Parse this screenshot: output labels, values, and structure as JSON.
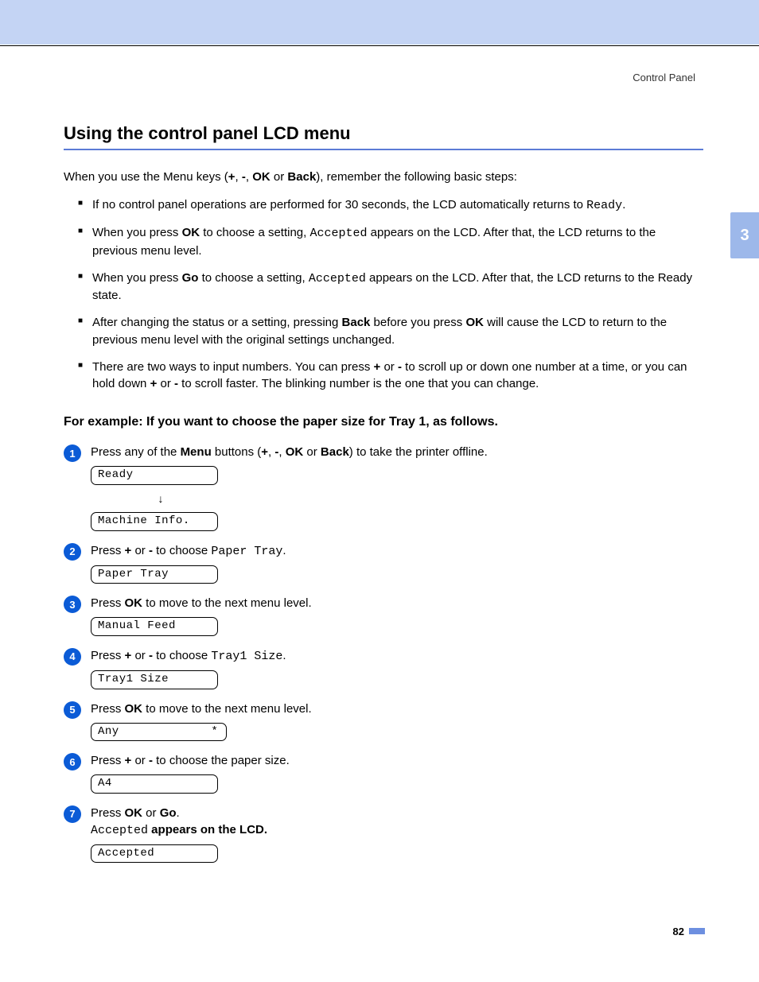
{
  "header": {
    "section": "Control Panel"
  },
  "sideTab": "3",
  "title": "Using the control panel LCD menu",
  "intro": {
    "pre": "When you use the Menu keys (",
    "k1": "+",
    "sep1": ", ",
    "k2": "-",
    "sep2": ", ",
    "k3": "OK",
    "sep3": " or ",
    "k4": "Back",
    "post": "), remember the following basic steps:"
  },
  "bullets": [
    {
      "parts": [
        {
          "t": "If no control panel operations are performed for 30 seconds, the LCD automatically returns to "
        },
        {
          "t": "Ready",
          "mono": true
        },
        {
          "t": "."
        }
      ]
    },
    {
      "parts": [
        {
          "t": "When you press "
        },
        {
          "t": "OK",
          "bold": true
        },
        {
          "t": " to choose a setting, "
        },
        {
          "t": "Accepted",
          "mono": true
        },
        {
          "t": " appears on the LCD. After that, the LCD returns to the previous menu level."
        }
      ]
    },
    {
      "parts": [
        {
          "t": "When you press "
        },
        {
          "t": "Go",
          "bold": true
        },
        {
          "t": " to choose a setting, "
        },
        {
          "t": "Accepted",
          "mono": true
        },
        {
          "t": " appears on the LCD. After that, the LCD returns to the Ready state."
        }
      ]
    },
    {
      "parts": [
        {
          "t": "After changing the status or a setting, pressing "
        },
        {
          "t": "Back",
          "bold": true
        },
        {
          "t": " before you press "
        },
        {
          "t": "OK",
          "bold": true
        },
        {
          "t": " will cause the LCD to return to the previous menu level with the original settings unchanged."
        }
      ]
    },
    {
      "parts": [
        {
          "t": "There are two ways to input numbers. You can press "
        },
        {
          "t": "+",
          "bold": true
        },
        {
          "t": " or "
        },
        {
          "t": "-",
          "bold": true
        },
        {
          "t": " to scroll up or down one number at a time, or you can hold down "
        },
        {
          "t": "+",
          "bold": true
        },
        {
          "t": " or "
        },
        {
          "t": "-",
          "bold": true
        },
        {
          "t": " to scroll faster. The blinking number is the one that you can change."
        }
      ]
    }
  ],
  "subheading": "For example: If you want to choose the paper size for Tray 1, as follows.",
  "steps": [
    {
      "num": "1",
      "text": [
        {
          "t": "Press any of the "
        },
        {
          "t": "Menu",
          "bold": true
        },
        {
          "t": " buttons ("
        },
        {
          "t": "+",
          "bold": true
        },
        {
          "t": ", "
        },
        {
          "t": "-",
          "bold": true
        },
        {
          "t": ", "
        },
        {
          "t": "OK",
          "bold": true
        },
        {
          "t": " or "
        },
        {
          "t": "Back",
          "bold": true
        },
        {
          "t": ") to take the printer offline."
        }
      ],
      "lcds": [
        "Ready"
      ],
      "arrowAfter": true,
      "lcds2": [
        "Machine Info."
      ]
    },
    {
      "num": "2",
      "text": [
        {
          "t": "Press "
        },
        {
          "t": "+",
          "bold": true
        },
        {
          "t": " or "
        },
        {
          "t": "-",
          "bold": true
        },
        {
          "t": " to choose "
        },
        {
          "t": "Paper Tray",
          "mono": true
        },
        {
          "t": "."
        }
      ],
      "lcds": [
        "Paper Tray"
      ]
    },
    {
      "num": "3",
      "text": [
        {
          "t": "Press "
        },
        {
          "t": "OK",
          "bold": true
        },
        {
          "t": " to move to the next menu level."
        }
      ],
      "lcds": [
        "Manual Feed"
      ]
    },
    {
      "num": "4",
      "text": [
        {
          "t": "Press "
        },
        {
          "t": "+",
          "bold": true
        },
        {
          "t": " or "
        },
        {
          "t": "-",
          "bold": true
        },
        {
          "t": " to choose "
        },
        {
          "t": "Tray1 Size",
          "mono": true
        },
        {
          "t": "."
        }
      ],
      "lcds": [
        "Tray1 Size"
      ]
    },
    {
      "num": "5",
      "text": [
        {
          "t": "Press "
        },
        {
          "t": "OK",
          "bold": true
        },
        {
          "t": " to move to the next menu level."
        }
      ],
      "lcds": [
        "Any             *"
      ]
    },
    {
      "num": "6",
      "text": [
        {
          "t": "Press "
        },
        {
          "t": "+",
          "bold": true
        },
        {
          "t": " or "
        },
        {
          "t": "-",
          "bold": true
        },
        {
          "t": " to choose the paper size."
        }
      ],
      "lcds": [
        "A4"
      ]
    },
    {
      "num": "7",
      "text": [
        {
          "t": "Press "
        },
        {
          "t": "OK",
          "bold": true
        },
        {
          "t": " or "
        },
        {
          "t": "Go",
          "bold": true
        },
        {
          "t": "."
        }
      ],
      "subline": [
        {
          "t": "Accepted",
          "mono": true
        },
        {
          "t": " appears on the LCD.",
          "bold": true
        }
      ],
      "lcds": [
        "Accepted"
      ]
    }
  ],
  "pageNumber": "82"
}
